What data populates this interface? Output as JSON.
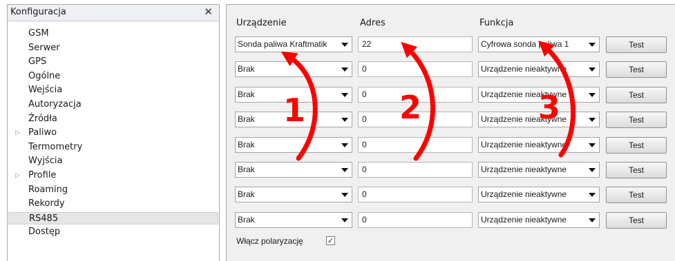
{
  "sidebar": {
    "title": "Konfiguracja",
    "close_glyph": "✕",
    "expander_glyph": "▷",
    "items": [
      {
        "label": "GSM",
        "expandable": false,
        "selected": false
      },
      {
        "label": "Serwer",
        "expandable": false,
        "selected": false
      },
      {
        "label": "GPS",
        "expandable": false,
        "selected": false
      },
      {
        "label": "Ogólne",
        "expandable": false,
        "selected": false
      },
      {
        "label": "Wejścia",
        "expandable": false,
        "selected": false
      },
      {
        "label": "Autoryzacja",
        "expandable": false,
        "selected": false
      },
      {
        "label": "Źródła",
        "expandable": false,
        "selected": false
      },
      {
        "label": "Paliwo",
        "expandable": true,
        "selected": false
      },
      {
        "label": "Termometry",
        "expandable": false,
        "selected": false
      },
      {
        "label": "Wyjścia",
        "expandable": false,
        "selected": false
      },
      {
        "label": "Profile",
        "expandable": true,
        "selected": false
      },
      {
        "label": "Roaming",
        "expandable": false,
        "selected": false
      },
      {
        "label": "Rekordy",
        "expandable": false,
        "selected": false
      },
      {
        "label": "RS485",
        "expandable": false,
        "selected": true
      },
      {
        "label": "Dostęp",
        "expandable": false,
        "selected": false
      }
    ]
  },
  "panel": {
    "headers": {
      "device": "Urządzenie",
      "address": "Adres",
      "function": "Funkcja"
    },
    "rows": [
      {
        "device": "Sonda paliwa Kraftmatik",
        "address": "22",
        "function": "Cyfrowa sonda paliwa 1",
        "test": "Test"
      },
      {
        "device": "Brak",
        "address": "0",
        "function": "Urządzenie nieaktywne",
        "test": "Test"
      },
      {
        "device": "Brak",
        "address": "0",
        "function": "Urządzenie nieaktywne",
        "test": "Test"
      },
      {
        "device": "Brak",
        "address": "0",
        "function": "Urządzenie nieaktywne",
        "test": "Test"
      },
      {
        "device": "Brak",
        "address": "0",
        "function": "Urządzenie nieaktywne",
        "test": "Test"
      },
      {
        "device": "Brak",
        "address": "0",
        "function": "Urządzenie nieaktywne",
        "test": "Test"
      },
      {
        "device": "Brak",
        "address": "0",
        "function": "Urządzenie nieaktywne",
        "test": "Test"
      },
      {
        "device": "Brak",
        "address": "0",
        "function": "Urządzenie nieaktywne",
        "test": "Test"
      }
    ],
    "polarization": {
      "label": "Włącz polaryzację",
      "checked": true,
      "check_glyph": "✓"
    }
  },
  "annotations": {
    "color": "#ff0000",
    "steps": [
      "1",
      "2",
      "3"
    ]
  }
}
